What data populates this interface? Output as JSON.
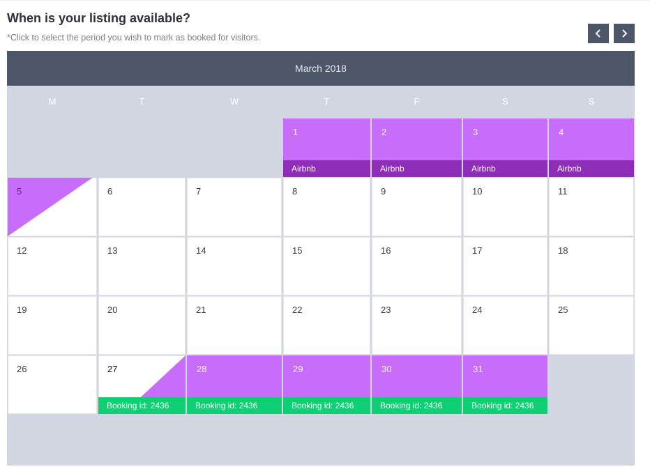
{
  "header": {
    "title": "When is your listing available?",
    "subtitle": "*Click to select the period you wish to mark as booked for visitors.",
    "prev_icon": "chevron-left-icon",
    "next_icon": "chevron-right-icon"
  },
  "calendar": {
    "month_label": "March 2018",
    "weekdays": [
      "M",
      "T",
      "W",
      "T",
      "F",
      "S",
      "S"
    ],
    "days": [
      {
        "day": "1",
        "status": "booked",
        "tag": "Airbnb",
        "tag_type": "airbnb"
      },
      {
        "day": "2",
        "status": "booked",
        "tag": "Airbnb",
        "tag_type": "airbnb"
      },
      {
        "day": "3",
        "status": "booked",
        "tag": "Airbnb",
        "tag_type": "airbnb"
      },
      {
        "day": "4",
        "status": "booked",
        "tag": "Airbnb",
        "tag_type": "airbnb"
      },
      {
        "day": "5",
        "status": "checkout",
        "tag": "",
        "tag_type": ""
      },
      {
        "day": "6",
        "status": "available",
        "tag": "",
        "tag_type": ""
      },
      {
        "day": "7",
        "status": "available",
        "tag": "",
        "tag_type": ""
      },
      {
        "day": "8",
        "status": "available",
        "tag": "",
        "tag_type": ""
      },
      {
        "day": "9",
        "status": "available",
        "tag": "",
        "tag_type": ""
      },
      {
        "day": "10",
        "status": "available",
        "tag": "",
        "tag_type": ""
      },
      {
        "day": "11",
        "status": "available",
        "tag": "",
        "tag_type": ""
      },
      {
        "day": "12",
        "status": "available",
        "tag": "",
        "tag_type": ""
      },
      {
        "day": "13",
        "status": "available",
        "tag": "",
        "tag_type": ""
      },
      {
        "day": "14",
        "status": "available",
        "tag": "",
        "tag_type": ""
      },
      {
        "day": "15",
        "status": "available",
        "tag": "",
        "tag_type": ""
      },
      {
        "day": "16",
        "status": "available",
        "tag": "",
        "tag_type": ""
      },
      {
        "day": "17",
        "status": "available",
        "tag": "",
        "tag_type": ""
      },
      {
        "day": "18",
        "status": "available",
        "tag": "",
        "tag_type": ""
      },
      {
        "day": "19",
        "status": "available",
        "tag": "",
        "tag_type": ""
      },
      {
        "day": "20",
        "status": "available",
        "tag": "",
        "tag_type": ""
      },
      {
        "day": "21",
        "status": "available",
        "tag": "",
        "tag_type": ""
      },
      {
        "day": "22",
        "status": "available",
        "tag": "",
        "tag_type": ""
      },
      {
        "day": "23",
        "status": "available",
        "tag": "",
        "tag_type": ""
      },
      {
        "day": "24",
        "status": "available",
        "tag": "",
        "tag_type": ""
      },
      {
        "day": "25",
        "status": "available",
        "tag": "",
        "tag_type": ""
      },
      {
        "day": "26",
        "status": "available",
        "tag": "",
        "tag_type": ""
      },
      {
        "day": "27",
        "status": "checkin",
        "tag": "Booking id: 2436",
        "tag_type": "booking"
      },
      {
        "day": "28",
        "status": "booked",
        "tag": "Booking id: 2436",
        "tag_type": "booking"
      },
      {
        "day": "29",
        "status": "booked",
        "tag": "Booking id: 2436",
        "tag_type": "booking"
      },
      {
        "day": "30",
        "status": "booked",
        "tag": "Booking id: 2436",
        "tag_type": "booking"
      },
      {
        "day": "31",
        "status": "booked",
        "tag": "Booking id: 2436",
        "tag_type": "booking"
      }
    ],
    "colors": {
      "booked": "#c86cfb",
      "airbnb_tag": "#8d2db8",
      "booking_tag": "#0ecf74",
      "header": "#4d5569",
      "empty": "#d2d6e0"
    }
  }
}
